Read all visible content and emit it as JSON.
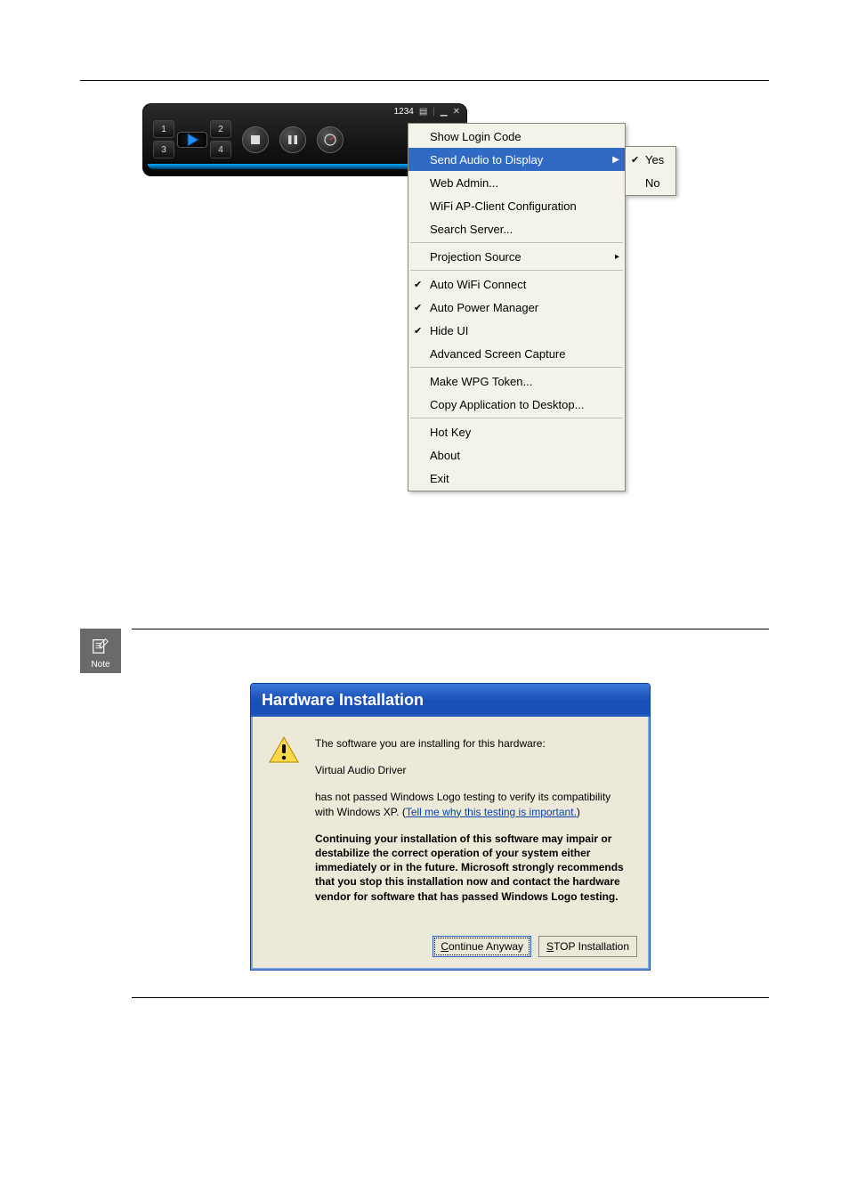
{
  "player": {
    "code": "1234",
    "q1": "1",
    "q2": "2",
    "q3": "3",
    "q4": "4"
  },
  "menu": {
    "show_login": "Show Login Code",
    "send_audio": "Send Audio to Display",
    "web_admin": "Web Admin...",
    "wifi_ap": "WiFi AP-Client Configuration",
    "search_server": "Search Server...",
    "proj_source": "Projection Source",
    "auto_wifi": "Auto WiFi Connect",
    "auto_power": "Auto Power Manager",
    "hide_ui": "Hide UI",
    "adv_capture": "Advanced Screen Capture",
    "make_token": "Make WPG Token...",
    "copy_app": "Copy Application to Desktop...",
    "hot_key": "Hot Key",
    "about": "About",
    "exit": "Exit"
  },
  "submenu": {
    "yes": "Yes",
    "no": "No"
  },
  "note": {
    "label": "Note"
  },
  "dialog": {
    "title": "Hardware Installation",
    "line1": "The software you are installing for this hardware:",
    "driver": "Virtual Audio Driver",
    "line2a": "has not passed Windows Logo testing to verify its compatibility with Windows XP. ",
    "link": "Tell me why this testing is important.",
    "warn": "Continuing your installation of this software may impair or destabilize the correct operation of your system either immediately or in the future. Microsoft strongly recommends that you stop this installation now and contact the hardware vendor for software that has passed Windows Logo testing.",
    "btn_continue": "ontinue Anyway",
    "btn_stop": "TOP Installation"
  }
}
